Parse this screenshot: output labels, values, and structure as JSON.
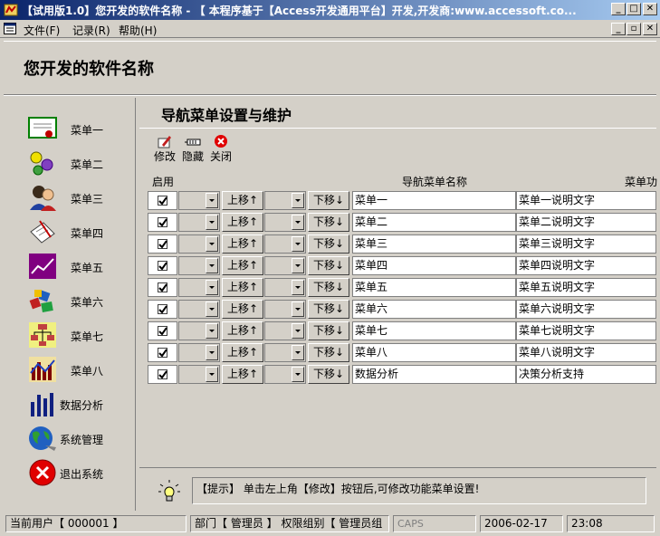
{
  "window": {
    "title": "【试用版1.0】您开发的软件名称 - 【 本程序基于【Access开发通用平台】开发,开发商:www.accessoft.co...",
    "controls": {
      "minimize": "_",
      "maximize": "□",
      "close": "✕"
    }
  },
  "menubar": {
    "items": [
      "文件(F)",
      "记录(R)",
      "帮助(H)"
    ],
    "controls": {
      "minimize": "_",
      "restore": "▫",
      "close": "✕"
    }
  },
  "header": {
    "app_name": "您开发的软件名称"
  },
  "sidebar": {
    "items": [
      {
        "label": "菜单一",
        "icon": "certificate-icon"
      },
      {
        "label": "菜单二",
        "icon": "shapes-icon"
      },
      {
        "label": "菜单三",
        "icon": "people-icon"
      },
      {
        "label": "菜单四",
        "icon": "notepad-icon"
      },
      {
        "label": "菜单五",
        "icon": "line-chart-icon"
      },
      {
        "label": "菜单六",
        "icon": "blocks-icon"
      },
      {
        "label": "菜单七",
        "icon": "org-chart-icon"
      },
      {
        "label": "菜单八",
        "icon": "bar-chart-icon"
      },
      {
        "label": "数据分析",
        "icon": "bars-icon"
      },
      {
        "label": "系统管理",
        "icon": "globe-icon"
      },
      {
        "label": "退出系统",
        "icon": "exit-icon"
      }
    ]
  },
  "main": {
    "title": "导航菜单设置与维护",
    "toolbar": {
      "edit": "修改",
      "hide": "隐藏",
      "close": "关闭"
    },
    "columns": {
      "enabled": "启用",
      "name": "导航菜单名称",
      "desc": "菜单功"
    },
    "move_up": "上移↑",
    "move_down": "下移↓",
    "rows": [
      {
        "name": "菜单一",
        "desc": "菜单一说明文字"
      },
      {
        "name": "菜单二",
        "desc": "菜单二说明文字"
      },
      {
        "name": "菜单三",
        "desc": "菜单三说明文字"
      },
      {
        "name": "菜单四",
        "desc": "菜单四说明文字"
      },
      {
        "name": "菜单五",
        "desc": "菜单五说明文字"
      },
      {
        "name": "菜单六",
        "desc": "菜单六说明文字"
      },
      {
        "name": "菜单七",
        "desc": "菜单七说明文字"
      },
      {
        "name": "菜单八",
        "desc": "菜单八说明文字"
      },
      {
        "name": "数据分析",
        "desc": "决策分析支持"
      }
    ],
    "hint": "【提示】 单击左上角【修改】按钮后,可修改功能菜单设置!"
  },
  "status": {
    "user": "当前用户【 000001 】",
    "dept": "部门【 管理员 】 权限组别【 管理员组",
    "caps": "CAPS",
    "date": "2006-02-17",
    "time": "23:08"
  }
}
